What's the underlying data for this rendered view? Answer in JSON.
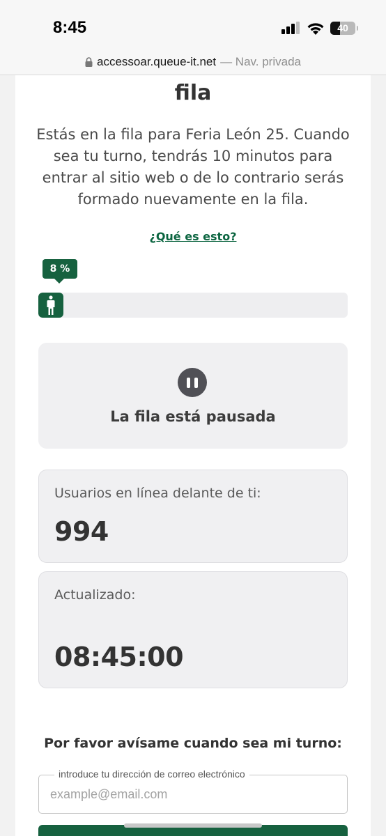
{
  "status_bar": {
    "time": "8:45",
    "battery_level": "40",
    "battery_fraction": 0.4
  },
  "browser": {
    "url_host": "accessoar.queue-it.net",
    "mode": "— Nav. privada"
  },
  "queue": {
    "title": "fila",
    "intro": "Estás en la fila para Feria León 25. Cuando sea tu turno, tendrás 10 minutos para entrar al sitio web o de lo contrario serás formado nuevamente en la fila.",
    "whats_this_link": "¿Qué es esto?",
    "progress_label": "8 %",
    "progress_fraction": 0.08,
    "paused_text": "La fila está pausada",
    "ahead_label": "Usuarios en línea delante de ti:",
    "ahead_count": "994",
    "updated_label": "Actualizado:",
    "updated_time": "08:45:00"
  },
  "notify": {
    "heading": "Por favor avísame cuando sea mi turno:",
    "email_legend": "introduce tu dirección de correo electrónico",
    "email_placeholder": "example@email.com"
  },
  "colors": {
    "brand_green": "#16613f",
    "panel_bg": "#f0f0f2"
  }
}
